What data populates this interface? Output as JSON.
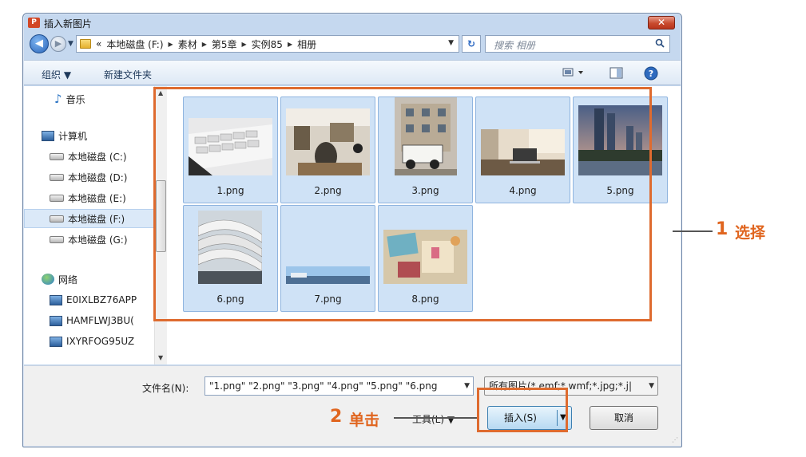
{
  "window": {
    "title": "插入新图片",
    "app_icon": "P",
    "close_glyph": "✕"
  },
  "nav": {
    "breadcrumb_prefix": "«",
    "breadcrumbs": [
      "本地磁盘 (F:)",
      "素材",
      "第5章",
      "实例85",
      "相册"
    ],
    "search_placeholder": "搜索 相册"
  },
  "toolbar": {
    "organize": "组织 ▼",
    "new_folder": "新建文件夹"
  },
  "sidebar": {
    "items": [
      {
        "label": "音乐",
        "icon": "music-icon"
      },
      {
        "label": "计算机",
        "icon": "computer-icon"
      },
      {
        "label": "本地磁盘 (C:)",
        "icon": "drive-icon"
      },
      {
        "label": "本地磁盘 (D:)",
        "icon": "drive-icon"
      },
      {
        "label": "本地磁盘 (E:)",
        "icon": "drive-icon"
      },
      {
        "label": "本地磁盘 (F:)",
        "icon": "drive-icon",
        "selected": true
      },
      {
        "label": "本地磁盘 (G:)",
        "icon": "drive-icon"
      },
      {
        "label": "网络",
        "icon": "network-icon"
      },
      {
        "label": "E0IXLBZ76APP",
        "icon": "computer-icon"
      },
      {
        "label": "HAMFLWJ3BU(",
        "icon": "computer-icon"
      },
      {
        "label": "IXYRFOG95UZ",
        "icon": "computer-icon"
      }
    ]
  },
  "files": [
    {
      "name": "1.png",
      "scene": "keyboard"
    },
    {
      "name": "2.png",
      "scene": "cafe"
    },
    {
      "name": "3.png",
      "scene": "jeep-building"
    },
    {
      "name": "4.png",
      "scene": "laptop-desk"
    },
    {
      "name": "5.png",
      "scene": "city-skyline"
    },
    {
      "name": "6.png",
      "scene": "architecture"
    },
    {
      "name": "7.png",
      "scene": "sky"
    },
    {
      "name": "8.png",
      "scene": "craft-table"
    }
  ],
  "bottom": {
    "filename_label": "文件名(N):",
    "filename_value": "\"1.png\" \"2.png\" \"3.png\" \"4.png\" \"5.png\" \"6.png",
    "filter_value": "所有图片(*.emf;*.wmf;*.jpg;*.j|",
    "tools_label": "工具(L)",
    "insert_label": "插入(S)",
    "cancel_label": "取消"
  },
  "annotations": {
    "step1_num": "1",
    "step1_text": "选择",
    "step2_num": "2",
    "step2_text": "单击"
  },
  "colors": {
    "accent_orange": "#de6b2f",
    "selection_blue": "#cfe2f6"
  }
}
